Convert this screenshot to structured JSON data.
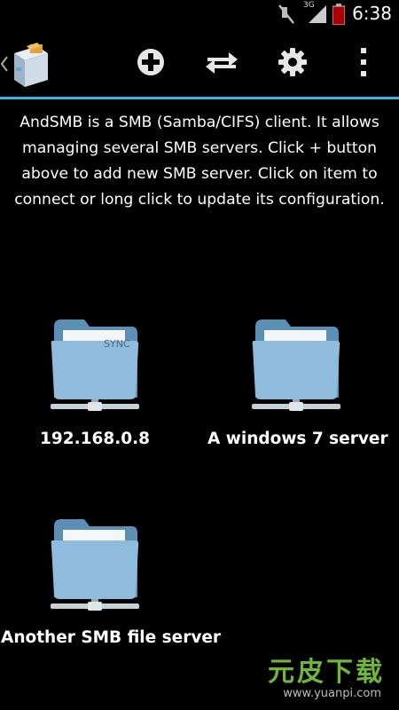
{
  "status_bar": {
    "time": "6:38",
    "network_type": "3G",
    "icons": [
      "mute-icon",
      "signal-icon",
      "battery-icon"
    ]
  },
  "action_bar": {
    "app_icon": "andsmb-app-icon",
    "actions": [
      {
        "name": "add-server-button",
        "icon": "plus-circle-icon"
      },
      {
        "name": "transfer-button",
        "icon": "swap-arrows-icon"
      },
      {
        "name": "settings-button",
        "icon": "gear-icon"
      },
      {
        "name": "overflow-menu-button",
        "icon": "vertical-dots-icon"
      }
    ],
    "accent_color": "#33b5e5"
  },
  "intro_text": "AndSMB is a SMB (Samba/CIFS) client. It allows managing several SMB servers. Click + button above to add new SMB server. Click on item to connect or long click to update its configuration.",
  "servers": [
    {
      "label": "192.168.0.8",
      "badge": "SYNC"
    },
    {
      "label": "A windows 7 server",
      "badge": ""
    },
    {
      "label": "Another SMB file server",
      "badge": ""
    }
  ],
  "watermark": {
    "title": "元皮下载",
    "url": "www.yuanpi.com"
  }
}
